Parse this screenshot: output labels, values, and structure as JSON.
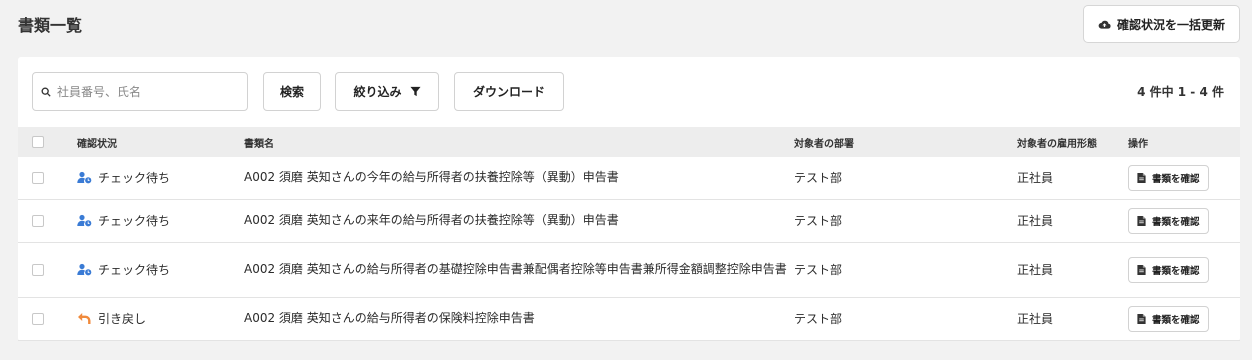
{
  "header": {
    "title": "書類一覧",
    "bulk_update_label": "確認状況を一括更新"
  },
  "toolbar": {
    "search_placeholder": "社員番号、氏名",
    "search_value": "",
    "search_button": "検索",
    "filter_button": "絞り込み",
    "download_button": "ダウンロード",
    "count": "4 件中 1 - 4 件"
  },
  "table": {
    "columns": [
      "確認状況",
      "書類名",
      "対象者の部署",
      "対象者の雇用形態",
      "操作"
    ],
    "rows": [
      {
        "status": "チェック待ち",
        "status_icon": "person-clock-icon",
        "name": "A002 須磨 英知さんの今年の給与所得者の扶養控除等（異動）申告書",
        "department": "テスト部",
        "employment": "正社員",
        "action": "書類を確認"
      },
      {
        "status": "チェック待ち",
        "status_icon": "person-clock-icon",
        "name": "A002 須磨 英知さんの来年の給与所得者の扶養控除等（異動）申告書",
        "department": "テスト部",
        "employment": "正社員",
        "action": "書類を確認"
      },
      {
        "status": "チェック待ち",
        "status_icon": "person-clock-icon",
        "name": "A002 須磨 英知さんの給与所得者の基礎控除申告書兼配偶者控除等申告書兼所得金額調整控除申告書",
        "department": "テスト部",
        "employment": "正社員",
        "action": "書類を確認"
      },
      {
        "status": "引き戻し",
        "status_icon": "undo-arrow-icon",
        "name": "A002 須磨 英知さんの給与所得者の保険料控除申告書",
        "department": "テスト部",
        "employment": "正社員",
        "action": "書類を確認"
      }
    ]
  },
  "colors": {
    "status_pending_icon": "#3a7bd5",
    "status_returned_icon": "#f08a3c",
    "header_row_bg": "#ededed",
    "page_bg": "#f2f2f2"
  }
}
